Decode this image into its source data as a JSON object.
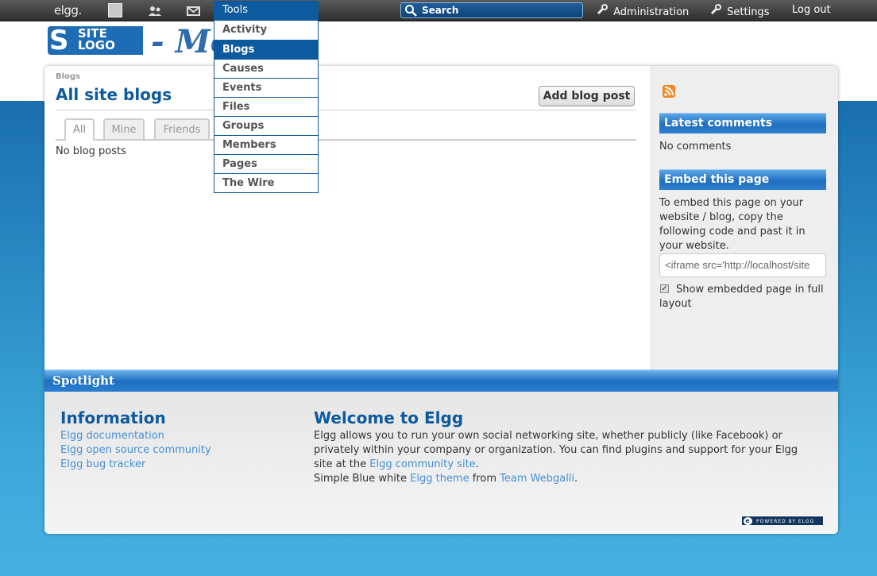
{
  "topbar": {
    "logo": "elgg.",
    "tools_label": "Tools",
    "search_label": "Search",
    "administration_label": "Administration",
    "settings_label": "Settings",
    "logout_label": "Log out"
  },
  "tools_menu": {
    "items": [
      {
        "label": "Activity"
      },
      {
        "label": "Blogs"
      },
      {
        "label": "Causes"
      },
      {
        "label": "Events"
      },
      {
        "label": "Files"
      },
      {
        "label": "Groups"
      },
      {
        "label": "Members"
      },
      {
        "label": "Pages"
      },
      {
        "label": "The Wire"
      }
    ],
    "active": "Blogs"
  },
  "header": {
    "logo_mark": "S",
    "logo_line1": "SITE",
    "logo_line2": "LOGO",
    "site_title": "- Me"
  },
  "main": {
    "breadcrumb": "Blogs",
    "title": "All site blogs",
    "add_button": "Add blog post",
    "tabs": [
      {
        "label": "All"
      },
      {
        "label": "Mine"
      },
      {
        "label": "Friends"
      }
    ],
    "empty_text": "No blog posts"
  },
  "sidebar": {
    "latest_comments_title": "Latest comments",
    "latest_comments_text": "No comments",
    "embed_title": "Embed this page",
    "embed_text": "To embed this page on your website / blog, copy the following code and past it in your website.",
    "embed_code": "<iframe src='http://localhost/site",
    "full_layout_label": "Show embedded page in full layout"
  },
  "spotlight": {
    "bar_label": "Spotlight",
    "info_title": "Information",
    "links": [
      "Elgg documentation",
      "Elgg open source community",
      "Elgg bug tracker"
    ],
    "welcome_title": "Welcome to Elgg",
    "welcome_text_1": "Elgg allows you to run your own social networking site, whether publicly (like Facebook) or privately within your company or organization. You can find plugins and support for your Elgg site at the ",
    "welcome_link_1": "Elgg community site",
    "welcome_text_2": ".",
    "theme_text_1": "Simple Blue white ",
    "theme_link_1": "Elgg theme",
    "theme_text_2": " from ",
    "theme_link_2": "Team Webgalli",
    "theme_text_3": ".",
    "powered_label": "POWERED BY ELGG"
  },
  "colors": {
    "accent": "#0d5a9e",
    "link": "#4690d6",
    "topbar": "#333333"
  }
}
